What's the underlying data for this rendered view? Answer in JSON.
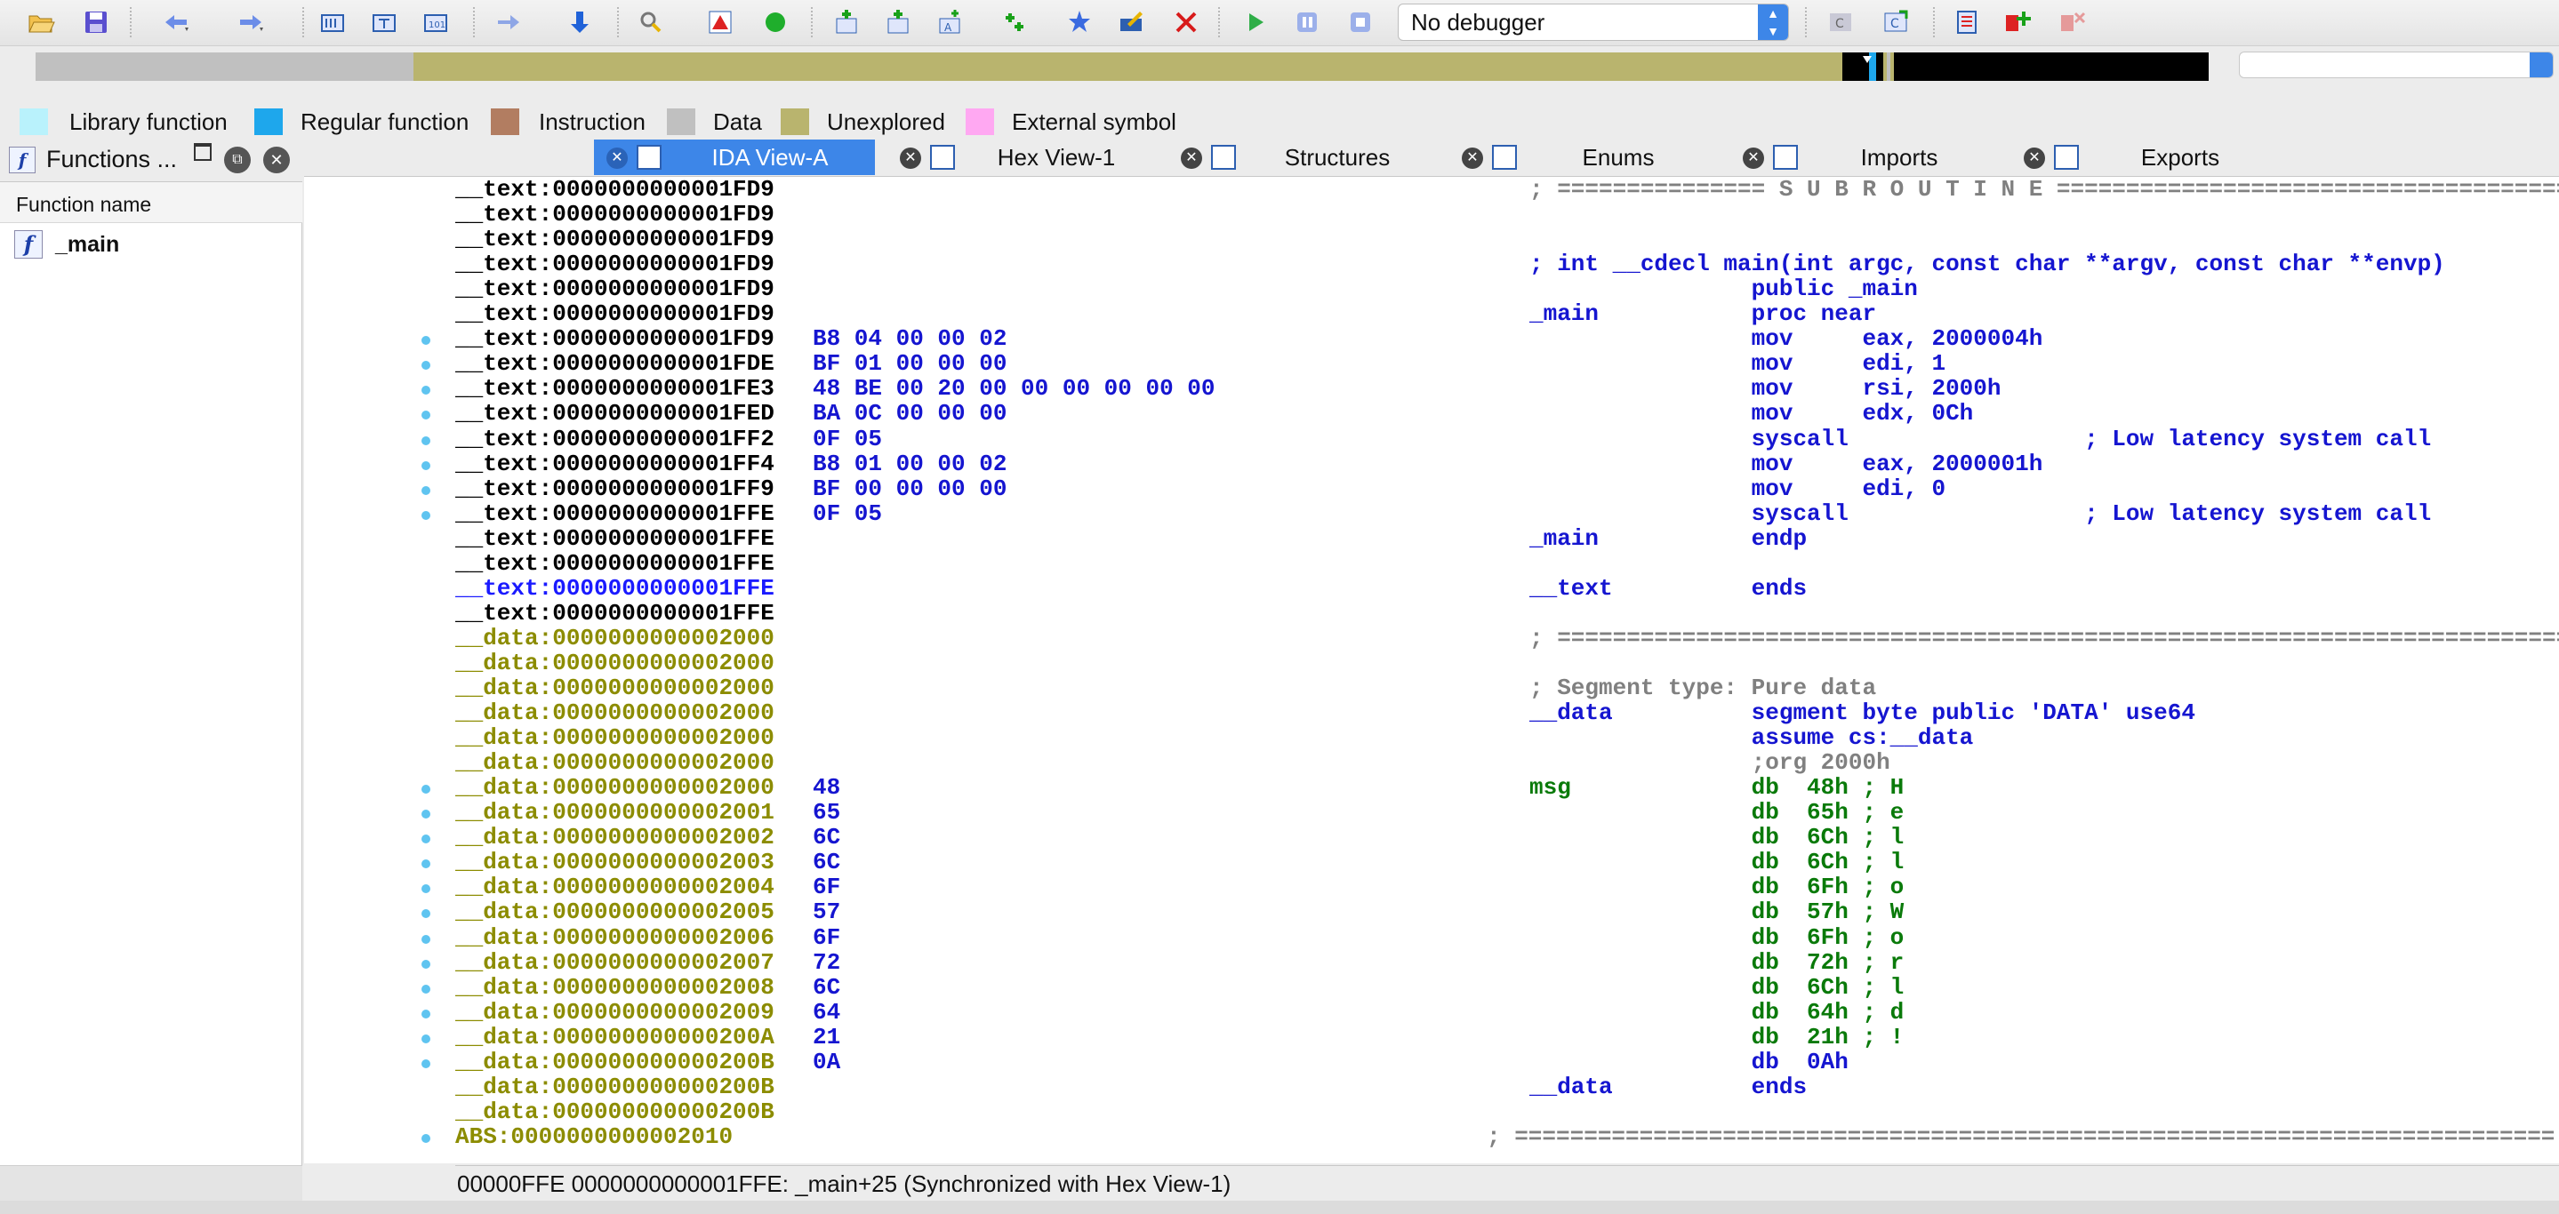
{
  "toolbar": {
    "debugger_select": "No debugger",
    "icons": [
      "open-icon",
      "save-icon",
      "back-icon",
      "forward-icon",
      "binary-icon",
      "text-icon",
      "hex-icon",
      "jump-icon",
      "down-arrow-icon",
      "search-icon",
      "warning-icon",
      "run-icon",
      "add-code-icon",
      "add-data-icon",
      "add-string-icon",
      "add-struct-icon",
      "star-icon",
      "edit-icon",
      "delete-icon",
      "play-icon",
      "pause-icon",
      "stop-icon",
      "breakpoint-icon",
      "trace-icon",
      "panel-icon",
      "add-bp-icon",
      "remove-bp-icon"
    ]
  },
  "legend": [
    {
      "label": "Library function",
      "color": "#b9f2fc"
    },
    {
      "label": "Regular function",
      "color": "#1ea7ec"
    },
    {
      "label": "Instruction",
      "color": "#b27d61"
    },
    {
      "label": "Data",
      "color": "#c0c0c0"
    },
    {
      "label": "Unexplored",
      "color": "#b9b46e"
    },
    {
      "label": "External symbol",
      "color": "#ffa8f2"
    }
  ],
  "sidebar": {
    "title": "Functions ...",
    "column": "Function name",
    "items": [
      {
        "label": "_main"
      }
    ]
  },
  "tabs": [
    {
      "label": "IDA View-A",
      "active": true
    },
    {
      "label": "Hex View-1",
      "active": false
    },
    {
      "label": "Structures",
      "active": false
    },
    {
      "label": "Enums",
      "active": false
    },
    {
      "label": "Imports",
      "active": false
    },
    {
      "label": "Exports",
      "active": false
    }
  ],
  "code": {
    "rows": [
      {
        "addr": "__text:0000000000001FD9",
        "seg": "text",
        "bytes": "",
        "asm": "; =============== S U B R O U T I N E =======================================",
        "dot": false
      },
      {
        "addr": "__text:0000000000001FD9",
        "seg": "text",
        "bytes": "",
        "asm": "",
        "dot": false
      },
      {
        "addr": "__text:0000000000001FD9",
        "seg": "text",
        "bytes": "",
        "asm": "",
        "dot": false
      },
      {
        "addr": "__text:0000000000001FD9",
        "seg": "text",
        "bytes": "",
        "asm": "; int __cdecl main(int argc, const char **argv, const char **envp)",
        "dot": false
      },
      {
        "addr": "__text:0000000000001FD9",
        "seg": "text",
        "bytes": "",
        "asm": "                public _main",
        "dot": false
      },
      {
        "addr": "__text:0000000000001FD9",
        "seg": "text",
        "bytes": "",
        "asm": "_main           proc near",
        "dot": false
      },
      {
        "addr": "__text:0000000000001FD9",
        "seg": "text",
        "bytes": "B8 04 00 00 02",
        "asm": "                mov     eax, 2000004h",
        "dot": true
      },
      {
        "addr": "__text:0000000000001FDE",
        "seg": "text",
        "bytes": "BF 01 00 00 00",
        "asm": "                mov     edi, 1",
        "dot": true
      },
      {
        "addr": "__text:0000000000001FE3",
        "seg": "text",
        "bytes": "48 BE 00 20 00 00 00 00 00 00",
        "asm": "                mov     rsi, 2000h",
        "dot": true
      },
      {
        "addr": "__text:0000000000001FED",
        "seg": "text",
        "bytes": "BA 0C 00 00 00",
        "asm": "                mov     edx, 0Ch",
        "dot": true
      },
      {
        "addr": "__text:0000000000001FF2",
        "seg": "text",
        "bytes": "0F 05",
        "asm": "                syscall                 ; Low latency system call",
        "dot": true
      },
      {
        "addr": "__text:0000000000001FF4",
        "seg": "text",
        "bytes": "B8 01 00 00 02",
        "asm": "                mov     eax, 2000001h",
        "dot": true
      },
      {
        "addr": "__text:0000000000001FF9",
        "seg": "text",
        "bytes": "BF 00 00 00 00",
        "asm": "                mov     edi, 0",
        "dot": true
      },
      {
        "addr": "__text:0000000000001FFE",
        "seg": "text",
        "bytes": "0F 05",
        "asm": "                syscall                 ; Low latency system call",
        "dot": true
      },
      {
        "addr": "__text:0000000000001FFE",
        "seg": "text",
        "bytes": "",
        "asm": "_main           endp",
        "dot": false
      },
      {
        "addr": "__text:0000000000001FFE",
        "seg": "text",
        "bytes": "",
        "asm": "",
        "dot": false
      },
      {
        "addr": "__text:0000000000001FFE",
        "seg": "sel",
        "bytes": "",
        "asm": "__text          ends",
        "dot": false
      },
      {
        "addr": "__text:0000000000001FFE",
        "seg": "text",
        "bytes": "",
        "asm": "",
        "dot": false
      },
      {
        "addr": "__data:0000000000002000",
        "seg": "data",
        "bytes": "",
        "asm": "; ===========================================================================",
        "dot": false
      },
      {
        "addr": "__data:0000000000002000",
        "seg": "data",
        "bytes": "",
        "asm": "",
        "dot": false
      },
      {
        "addr": "__data:0000000000002000",
        "seg": "data",
        "bytes": "",
        "asm": "; Segment type: Pure data",
        "dot": false
      },
      {
        "addr": "__data:0000000000002000",
        "seg": "data",
        "bytes": "",
        "asm": "__data          segment byte public 'DATA' use64",
        "dot": false
      },
      {
        "addr": "__data:0000000000002000",
        "seg": "data",
        "bytes": "",
        "asm": "                assume cs:__data",
        "dot": false
      },
      {
        "addr": "__data:0000000000002000",
        "seg": "data",
        "bytes": "",
        "asm": "                ;org 2000h",
        "dot": false
      },
      {
        "addr": "__data:0000000000002000",
        "seg": "data",
        "bytes": "48",
        "asm": "msg             db  48h ; H",
        "dot": true
      },
      {
        "addr": "__data:0000000000002001",
        "seg": "data",
        "bytes": "65",
        "asm": "                db  65h ; e",
        "dot": true
      },
      {
        "addr": "__data:0000000000002002",
        "seg": "data",
        "bytes": "6C",
        "asm": "                db  6Ch ; l",
        "dot": true
      },
      {
        "addr": "__data:0000000000002003",
        "seg": "data",
        "bytes": "6C",
        "asm": "                db  6Ch ; l",
        "dot": true
      },
      {
        "addr": "__data:0000000000002004",
        "seg": "data",
        "bytes": "6F",
        "asm": "                db  6Fh ; o",
        "dot": true
      },
      {
        "addr": "__data:0000000000002005",
        "seg": "data",
        "bytes": "57",
        "asm": "                db  57h ; W",
        "dot": true
      },
      {
        "addr": "__data:0000000000002006",
        "seg": "data",
        "bytes": "6F",
        "asm": "                db  6Fh ; o",
        "dot": true
      },
      {
        "addr": "__data:0000000000002007",
        "seg": "data",
        "bytes": "72",
        "asm": "                db  72h ; r",
        "dot": true
      },
      {
        "addr": "__data:0000000000002008",
        "seg": "data",
        "bytes": "6C",
        "asm": "                db  6Ch ; l",
        "dot": true
      },
      {
        "addr": "__data:0000000000002009",
        "seg": "data",
        "bytes": "64",
        "asm": "                db  64h ; d",
        "dot": true
      },
      {
        "addr": "__data:000000000000200A",
        "seg": "data",
        "bytes": "21",
        "asm": "                db  21h ; !",
        "dot": true
      },
      {
        "addr": "__data:000000000000200B",
        "seg": "data",
        "bytes": "0A",
        "asm": "                db  0Ah",
        "dot": true
      },
      {
        "addr": "__data:000000000000200B",
        "seg": "data",
        "bytes": "",
        "asm": "__data          ends",
        "dot": false
      },
      {
        "addr": "__data:000000000000200B",
        "seg": "data",
        "bytes": "",
        "asm": "",
        "dot": false
      },
      {
        "addr": "ABS:0000000000002010",
        "seg": "data",
        "bytes": "",
        "asm": "; ===========================================================================",
        "dot": true
      }
    ]
  },
  "status": "00000FFE 0000000000001FFE: _main+25 (Synchronized with Hex View-1)"
}
